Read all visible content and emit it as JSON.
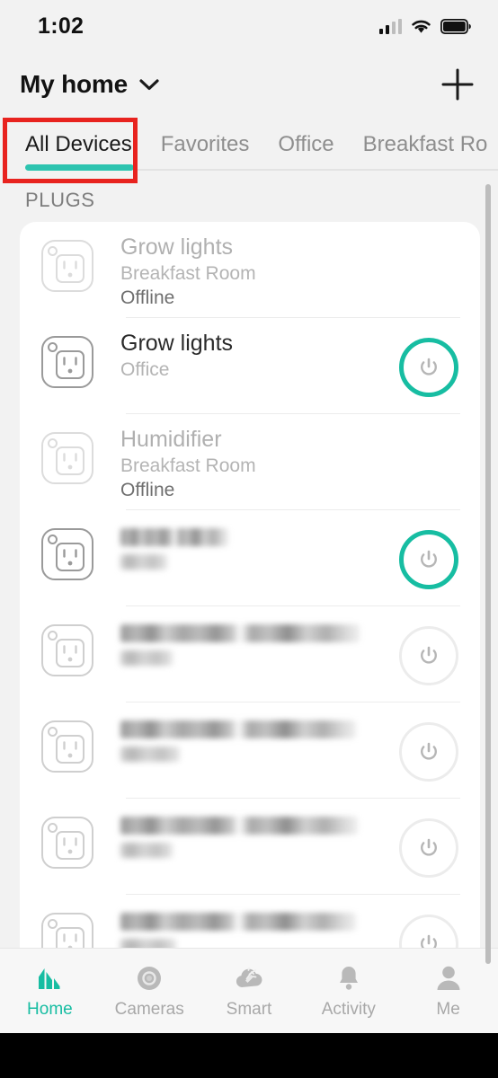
{
  "status_bar": {
    "time": "1:02",
    "signal_icon": "cellular-signal-icon",
    "wifi_icon": "wifi-icon",
    "battery_icon": "battery-full-icon"
  },
  "header": {
    "home_name": "My home",
    "chevron_icon": "chevron-down-icon",
    "add_icon": "plus-icon"
  },
  "tabs": {
    "items": [
      {
        "label": "All Devices",
        "active": true
      },
      {
        "label": "Favorites",
        "active": false
      },
      {
        "label": "Office",
        "active": false
      },
      {
        "label": "Breakfast Ro",
        "active": false
      }
    ],
    "menu_icon": "hamburger-menu-icon",
    "active_underline_color": "#2ec4b0"
  },
  "annotation": {
    "color": "#e8231f",
    "target": "All Devices"
  },
  "section": {
    "label": "PLUGS"
  },
  "devices": [
    {
      "name": "Grow lights",
      "room": "Breakfast Room",
      "status": "Offline",
      "offline": true,
      "redacted": false,
      "power": "none"
    },
    {
      "name": "Grow lights",
      "room": "Office",
      "status": "",
      "offline": false,
      "redacted": false,
      "power": "on"
    },
    {
      "name": "Humidifier",
      "room": "Breakfast Room",
      "status": "Offline",
      "offline": true,
      "redacted": false,
      "power": "none"
    },
    {
      "name": "",
      "room": "",
      "status": "",
      "offline": false,
      "redacted": true,
      "redacted_name_width": 120,
      "redacted_room_width": 52,
      "power": "on"
    },
    {
      "name": "",
      "room": "",
      "status": "",
      "offline": false,
      "redacted": true,
      "redacted_name_width": 266,
      "redacted_room_width": 58,
      "power": "off"
    },
    {
      "name": "",
      "room": "",
      "status": "",
      "offline": false,
      "redacted": true,
      "redacted_name_width": 262,
      "redacted_room_width": 66,
      "power": "off"
    },
    {
      "name": "",
      "room": "",
      "status": "",
      "offline": false,
      "redacted": true,
      "redacted_name_width": 264,
      "redacted_room_width": 58,
      "power": "off"
    },
    {
      "name": "",
      "room": "",
      "status": "",
      "offline": false,
      "redacted": true,
      "redacted_name_width": 262,
      "redacted_room_width": 62,
      "power": "off"
    }
  ],
  "bottom_nav": {
    "accent_color": "#17bda2",
    "inactive_color": "#a8a8a8",
    "items": [
      {
        "label": "Home",
        "icon": "home-icon",
        "active": true
      },
      {
        "label": "Cameras",
        "icon": "camera-icon",
        "active": false
      },
      {
        "label": "Smart",
        "icon": "smart-cloud-icon",
        "active": false
      },
      {
        "label": "Activity",
        "icon": "bell-icon",
        "active": false
      },
      {
        "label": "Me",
        "icon": "person-icon",
        "active": false
      }
    ]
  }
}
